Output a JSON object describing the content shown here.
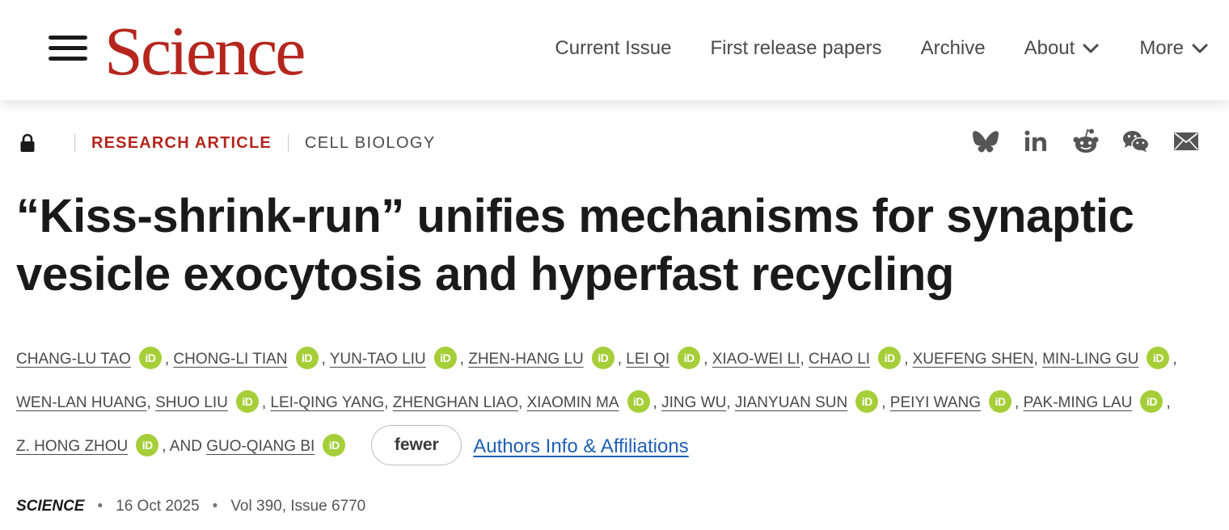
{
  "header": {
    "logo_text": "Science",
    "nav": [
      {
        "label": "Current Issue"
      },
      {
        "label": "First release papers"
      },
      {
        "label": "Archive"
      },
      {
        "label": "About"
      },
      {
        "label": "More"
      }
    ]
  },
  "category": {
    "type": "RESEARCH ARTICLE",
    "subject": "CELL BIOLOGY"
  },
  "share_icons": [
    "bluesky-icon",
    "linkedin-icon",
    "reddit-icon",
    "wechat-icon",
    "email-icon"
  ],
  "article": {
    "title_line1": "“Kiss-shrink-run” unifies mechanisms for synaptic",
    "title_line2": "vesicle exocytosis and hyperfast recycling",
    "authors": [
      {
        "name": "CHANG-LU TAO",
        "orcid": true
      },
      {
        "name": "CHONG-LI TIAN",
        "orcid": true
      },
      {
        "name": "YUN-TAO LIU",
        "orcid": true
      },
      {
        "name": "ZHEN-HANG LU",
        "orcid": true
      },
      {
        "name": "LEI QI",
        "orcid": true
      },
      {
        "name": "XIAO-WEI LI",
        "orcid": false
      },
      {
        "name": "CHAO LI",
        "orcid": true
      },
      {
        "name": "XUEFENG SHEN",
        "orcid": false
      },
      {
        "name": "MIN-LING GU",
        "orcid": true
      },
      {
        "name": "WEN-LAN HUANG",
        "orcid": false
      },
      {
        "name": "SHUO LIU",
        "orcid": true
      },
      {
        "name": "LEI-QING YANG",
        "orcid": false
      },
      {
        "name": "ZHENGHAN LIAO",
        "orcid": false
      },
      {
        "name": "XIAOMIN MA",
        "orcid": true
      },
      {
        "name": "JING WU",
        "orcid": false
      },
      {
        "name": "JIANYUAN SUN",
        "orcid": true
      },
      {
        "name": "PEIYI WANG",
        "orcid": true
      },
      {
        "name": "PAK-MING LAU",
        "orcid": true
      },
      {
        "name": "Z. HONG ZHOU",
        "orcid": true
      },
      {
        "name": "GUO-QIANG BI",
        "orcid": true
      }
    ],
    "and_text": "AND",
    "orcid_label": "iD",
    "fewer_label": "fewer",
    "affiliations_link": "Authors Info & Affiliations",
    "journal": "SCIENCE",
    "date": "16 Oct 2025",
    "volume": "Vol 390, Issue 6770"
  },
  "colors": {
    "brand_red": "#b5261e",
    "orcid_green": "#a6ce39",
    "link_blue": "#1f5fb6"
  }
}
